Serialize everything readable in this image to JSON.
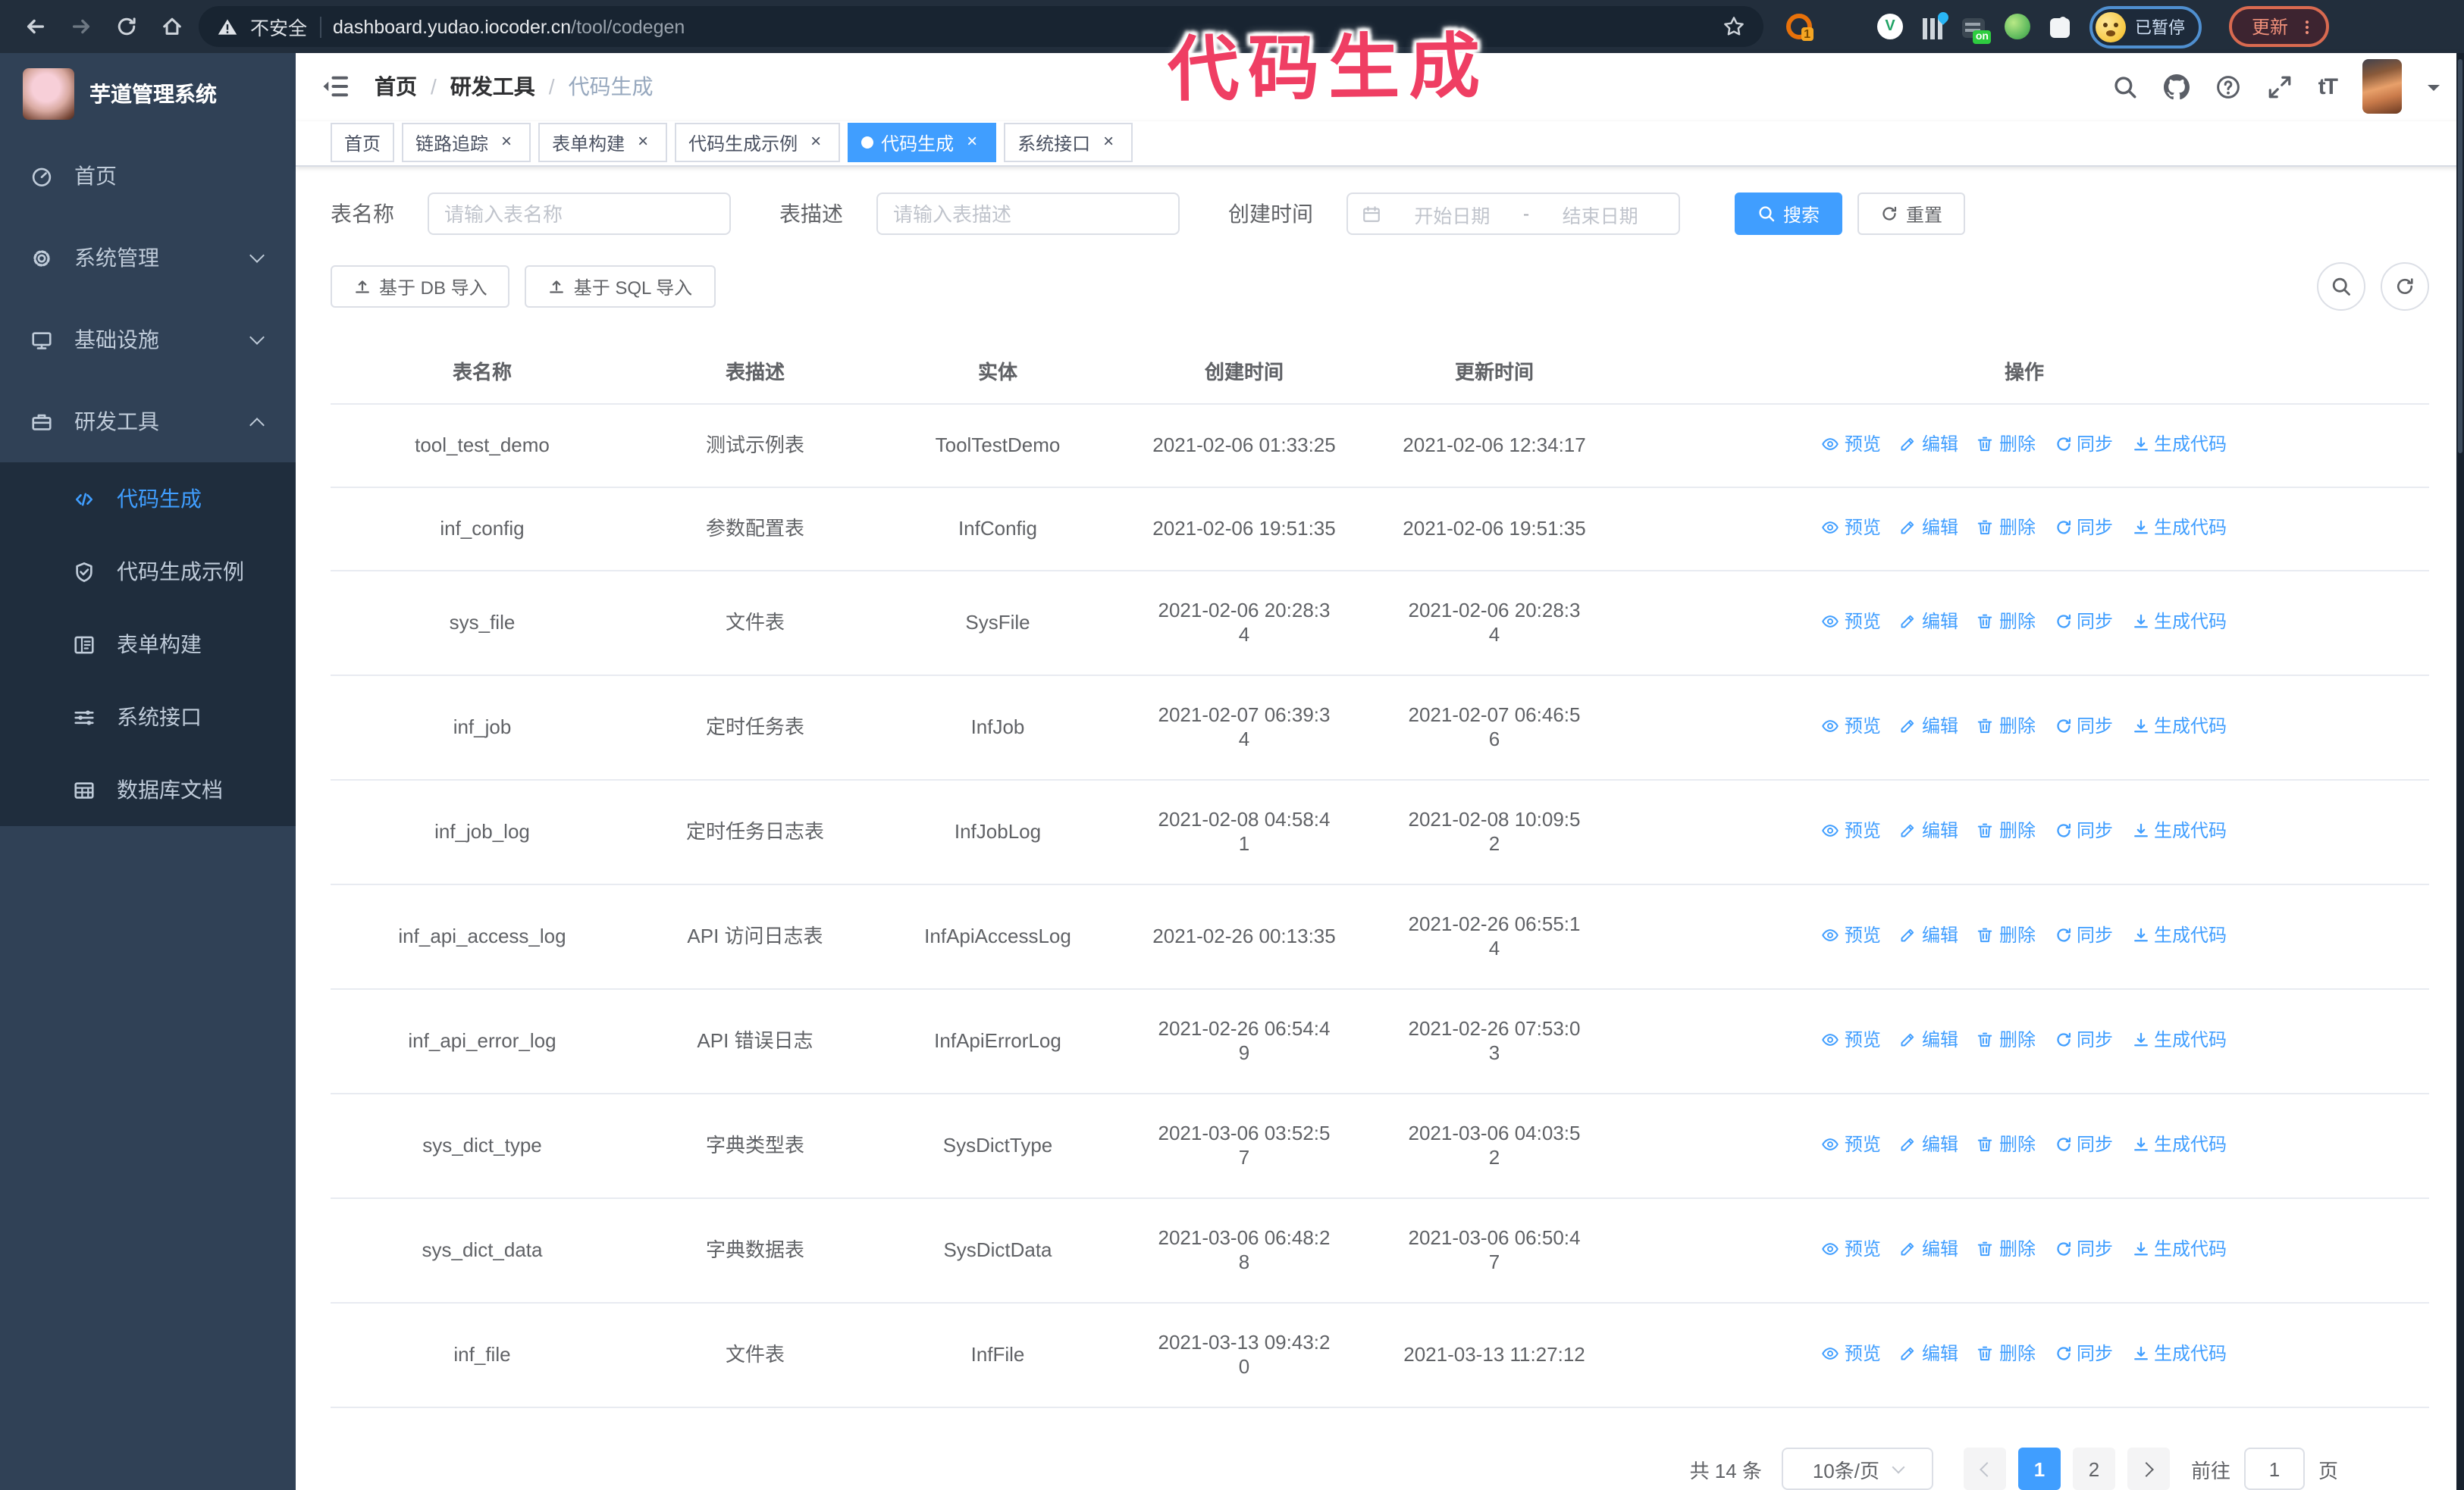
{
  "browser": {
    "security_label": "不安全",
    "url_host": "dashboard.yudao.iocoder.cn",
    "url_path": "/tool/codegen",
    "ext_orange_badge": "1",
    "ext_v_glyph": "V",
    "ext_on_badge": "on",
    "paused_badge": "已暂停",
    "update_button": "更新"
  },
  "annotation": {
    "text": "代码生成",
    "color": "#ef3e63"
  },
  "sidebar": {
    "logo_title": "芋道管理系统",
    "items": [
      {
        "icon": "dashboard",
        "icon_name": "dashboard-icon",
        "label": "首页",
        "kind": "item",
        "chevron": "none",
        "active": "false"
      },
      {
        "icon": "gear",
        "icon_name": "gear-icon",
        "label": "系统管理",
        "kind": "item",
        "chevron": "down",
        "active": "false"
      },
      {
        "icon": "monitor",
        "icon_name": "monitor-icon",
        "label": "基础设施",
        "kind": "item",
        "chevron": "down",
        "active": "false"
      },
      {
        "icon": "tools",
        "icon_name": "toolbox-icon",
        "label": "研发工具",
        "kind": "item",
        "chevron": "up",
        "active": "false"
      },
      {
        "icon": "code",
        "icon_name": "code-icon",
        "label": "代码生成",
        "kind": "sub",
        "chevron": "none",
        "active": "true"
      },
      {
        "icon": "example",
        "icon_name": "shield-check-icon",
        "label": "代码生成示例",
        "kind": "sub",
        "chevron": "none",
        "active": "false"
      },
      {
        "icon": "form",
        "icon_name": "form-icon",
        "label": "表单构建",
        "kind": "sub",
        "chevron": "none",
        "active": "false"
      },
      {
        "icon": "api",
        "icon_name": "sliders-icon",
        "label": "系统接口",
        "kind": "sub",
        "chevron": "none",
        "active": "false"
      },
      {
        "icon": "db",
        "icon_name": "table-grid-icon",
        "label": "数据库文档",
        "kind": "sub",
        "chevron": "none",
        "active": "false"
      }
    ]
  },
  "navbar": {
    "breadcrumb": [
      {
        "label": "首页",
        "last": "false"
      },
      {
        "label": "研发工具",
        "last": "false"
      },
      {
        "label": "代码生成",
        "last": "true"
      }
    ]
  },
  "tabs": [
    {
      "label": "首页",
      "active": "false",
      "closable": "false"
    },
    {
      "label": "链路追踪",
      "active": "false",
      "closable": "true"
    },
    {
      "label": "表单构建",
      "active": "false",
      "closable": "true"
    },
    {
      "label": "代码生成示例",
      "active": "false",
      "closable": "true"
    },
    {
      "label": "代码生成",
      "active": "true",
      "closable": "true"
    },
    {
      "label": "系统接口",
      "active": "false",
      "closable": "true"
    }
  ],
  "filters": {
    "name_label": "表名称",
    "name_placeholder": "请输入表名称",
    "desc_label": "表描述",
    "desc_placeholder": "请输入表描述",
    "time_label": "创建时间",
    "start_placeholder": "开始日期",
    "range_separator": "-",
    "end_placeholder": "结束日期",
    "search_label": "搜索",
    "reset_label": "重置"
  },
  "toolbar": {
    "import_db": "基于 DB 导入",
    "import_sql": "基于 SQL 导入"
  },
  "table": {
    "headers": [
      "表名称",
      "表描述",
      "实体",
      "创建时间",
      "更新时间",
      "操作"
    ],
    "row_actions": [
      {
        "icon": "eye",
        "icon_name": "eye-icon",
        "label": "预览"
      },
      {
        "icon": "edit",
        "icon_name": "edit-icon",
        "label": "编辑"
      },
      {
        "icon": "delete",
        "icon_name": "trash-icon",
        "label": "删除"
      },
      {
        "icon": "sync",
        "icon_name": "sync-icon",
        "label": "同步"
      },
      {
        "icon": "download",
        "icon_name": "download-icon",
        "label": "生成代码"
      }
    ],
    "rows": [
      {
        "name": "tool_test_demo",
        "desc": "测试示例表",
        "entity": "ToolTestDemo",
        "created": "2021-02-06 01:33:25",
        "updated": "2021-02-06 12:34:17"
      },
      {
        "name": "inf_config",
        "desc": "参数配置表",
        "entity": "InfConfig",
        "created": "2021-02-06 19:51:35",
        "updated": "2021-02-06 19:51:35"
      },
      {
        "name": "sys_file",
        "desc": "文件表",
        "entity": "SysFile",
        "created": "2021-02-06 20:28:3\n4",
        "updated": "2021-02-06 20:28:3\n4"
      },
      {
        "name": "inf_job",
        "desc": "定时任务表",
        "entity": "InfJob",
        "created": "2021-02-07 06:39:3\n4",
        "updated": "2021-02-07 06:46:5\n6"
      },
      {
        "name": "inf_job_log",
        "desc": "定时任务日志表",
        "entity": "InfJobLog",
        "created": "2021-02-08 04:58:4\n1",
        "updated": "2021-02-08 10:09:5\n2"
      },
      {
        "name": "inf_api_access_log",
        "desc": "API 访问日志表",
        "entity": "InfApiAccessLog",
        "created": "2021-02-26 00:13:35",
        "updated": "2021-02-26 06:55:1\n4"
      },
      {
        "name": "inf_api_error_log",
        "desc": "API 错误日志",
        "entity": "InfApiErrorLog",
        "created": "2021-02-26 06:54:4\n9",
        "updated": "2021-02-26 07:53:0\n3"
      },
      {
        "name": "sys_dict_type",
        "desc": "字典类型表",
        "entity": "SysDictType",
        "created": "2021-03-06 03:52:5\n7",
        "updated": "2021-03-06 04:03:5\n2"
      },
      {
        "name": "sys_dict_data",
        "desc": "字典数据表",
        "entity": "SysDictData",
        "created": "2021-03-06 06:48:2\n8",
        "updated": "2021-03-06 06:50:4\n7"
      },
      {
        "name": "inf_file",
        "desc": "文件表",
        "entity": "InfFile",
        "created": "2021-03-13 09:43:2\n0",
        "updated": "2021-03-13 11:27:12"
      }
    ]
  },
  "pagination": {
    "total": "共 14 条",
    "page_size": "10条/页",
    "pages": [
      {
        "label": "1",
        "active": "true"
      },
      {
        "label": "2",
        "active": "false"
      }
    ],
    "goto_label": "前往",
    "goto_value": "1",
    "page_suffix": "页"
  },
  "ui": {
    "breadcrumb_separator": "/",
    "close_glyph": "×",
    "font_size_glyph": "tT"
  },
  "colors": {
    "accent": "#409EFF",
    "sidebar_bg": "#304156",
    "submenu_bg": "#1f2d3d",
    "annotation": "#ef3e63",
    "update_button_border": "#d96a50"
  }
}
